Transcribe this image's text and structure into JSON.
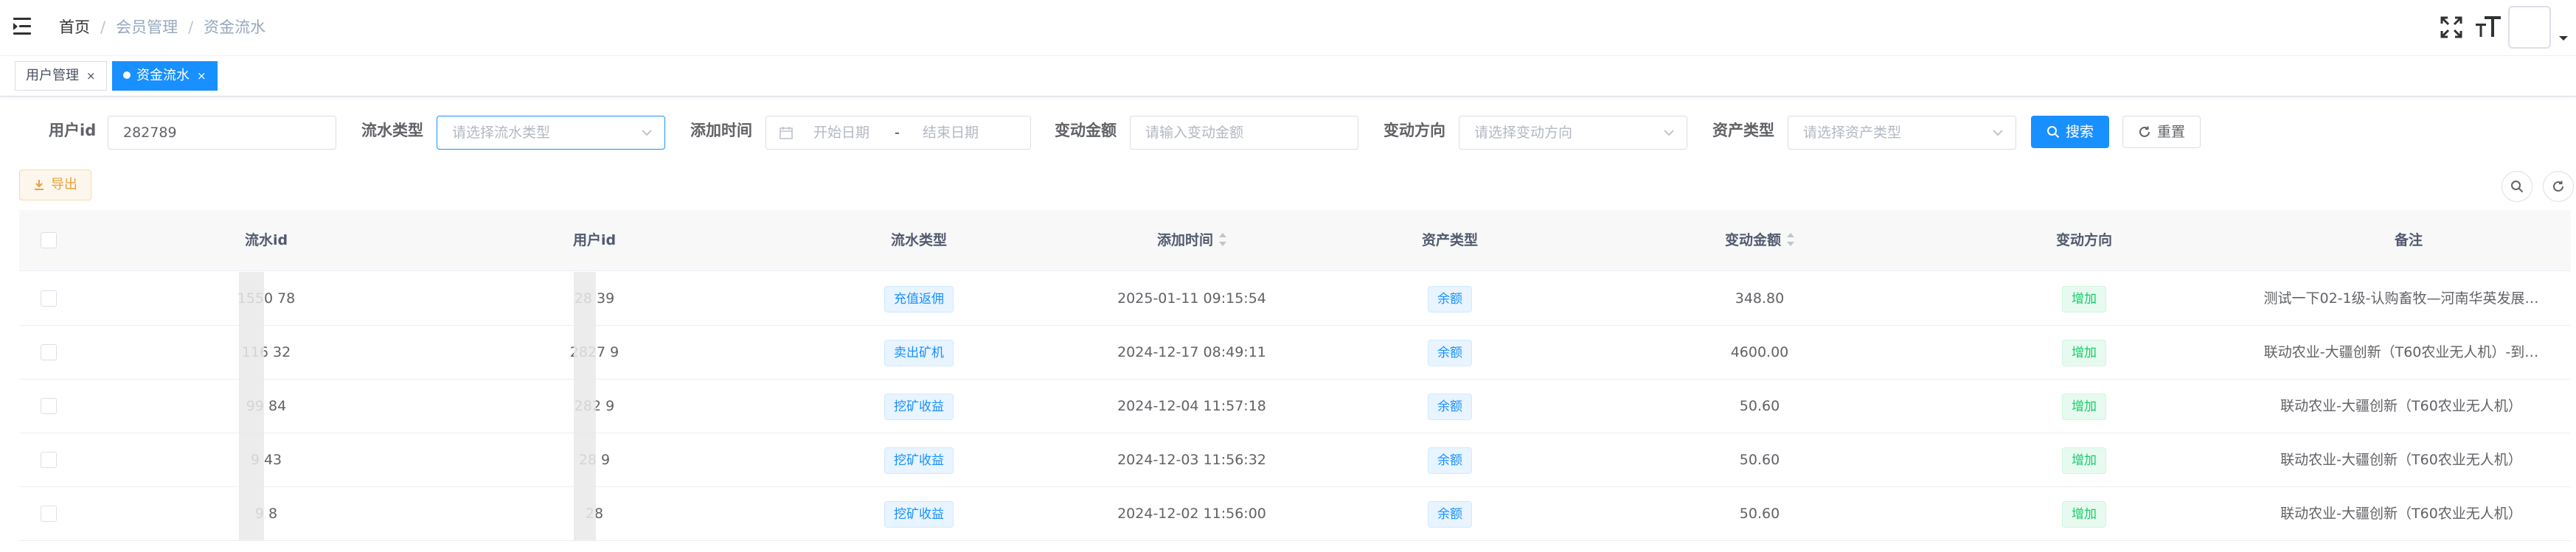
{
  "breadcrumb": {
    "home": "首页",
    "sep": "/",
    "section": "会员管理",
    "page": "资金流水"
  },
  "tabs": [
    {
      "label": "用户管理",
      "close": "×"
    },
    {
      "label": "资金流水",
      "close": "×"
    }
  ],
  "filters": {
    "user_id": {
      "label": "用户id",
      "value": "282789"
    },
    "flow_type": {
      "label": "流水类型",
      "placeholder": "请选择流水类型"
    },
    "add_time": {
      "label": "添加时间",
      "start": "开始日期",
      "dash": "-",
      "end": "结束日期"
    },
    "amount": {
      "label": "变动金额",
      "placeholder": "请输入变动金额"
    },
    "direction": {
      "label": "变动方向",
      "placeholder": "请选择变动方向"
    },
    "asset_type": {
      "label": "资产类型",
      "placeholder": "请选择资产类型"
    },
    "search_button": "搜索",
    "reset_button": "重置"
  },
  "toolbar": {
    "export_button": "导出"
  },
  "table": {
    "headers": [
      "流水id",
      "用户id",
      "流水类型",
      "添加时间",
      "资产类型",
      "变动金额",
      "变动方向",
      "备注"
    ],
    "rows": [
      {
        "flow_id": "1550  78",
        "user_id": "28  39",
        "type": "充值返佣",
        "time": "2025-01-11 09:15:54",
        "asset": "余额",
        "amount": "348.80",
        "direction": "增加",
        "remark": "测试一下02-1级-认购畜牧—河南华英发展…"
      },
      {
        "flow_id": "116  32",
        "user_id": "2827  9",
        "type": "卖出矿机",
        "time": "2024-12-17 08:49:11",
        "asset": "余额",
        "amount": "4600.00",
        "direction": "增加",
        "remark": "联动农业-大疆创新（T60农业无人机）-到…"
      },
      {
        "flow_id": "99  84",
        "user_id": "282  9",
        "type": "挖矿收益",
        "time": "2024-12-04 11:57:18",
        "asset": "余额",
        "amount": "50.60",
        "direction": "增加",
        "remark": "联动农业-大疆创新（T60农业无人机）"
      },
      {
        "flow_id": "9  43",
        "user_id": "28  9",
        "type": "挖矿收益",
        "time": "2024-12-03 11:56:32",
        "asset": "余额",
        "amount": "50.60",
        "direction": "增加",
        "remark": "联动农业-大疆创新（T60农业无人机）"
      },
      {
        "flow_id": "9  8",
        "user_id": "28  ",
        "type": "挖矿收益",
        "time": "2024-12-02 11:56:00",
        "asset": "余额",
        "amount": "50.60",
        "direction": "增加",
        "remark": "联动农业-大疆创新（T60农业无人机）"
      }
    ]
  },
  "icons": {
    "hamburger": "hamburger-icon",
    "fullscreen": "fullscreen-icon",
    "size": "text-size-icon",
    "calendar": "calendar-icon",
    "search": "search-icon",
    "refresh": "refresh-icon",
    "download": "download-icon"
  },
  "colors": {
    "primary": "#1890ff",
    "success": "#13ce66",
    "warning": "#e6a23c"
  }
}
